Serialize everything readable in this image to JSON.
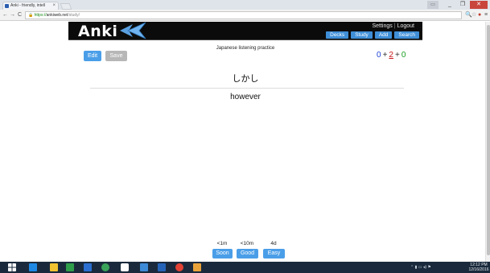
{
  "browser": {
    "tab_title": "Anki - friendly, intell",
    "tab_close": "×",
    "window_user": "▭",
    "window_min": "_",
    "window_max": "❐",
    "window_close": "✕",
    "nav_back": "←",
    "nav_forward": "→",
    "nav_reload": "C",
    "url_scheme": "https://",
    "url_host": "ankiweb.net",
    "url_path": "/study/",
    "icon_search": "🔍",
    "icon_star": "☆",
    "icon_ext": "●",
    "icon_menu": "≡"
  },
  "header": {
    "logo": "Anki",
    "settings": "Settings",
    "separator": "|",
    "logout": "Logout",
    "nav": [
      "Decks",
      "Study",
      "Add",
      "Search"
    ]
  },
  "study": {
    "edit_label": "Edit",
    "save_label": "Save",
    "deck_name": "Japanese listening practice",
    "counts": {
      "new": "0",
      "learn": "2",
      "review": "0",
      "plus": "+"
    },
    "front": "しかし",
    "back": "however",
    "answers": [
      {
        "time": "<1m",
        "label": "Soon"
      },
      {
        "time": "<10m",
        "label": "Good"
      },
      {
        "time": "4d",
        "label": "Easy"
      }
    ]
  },
  "taskbar": {
    "tray": "⌃ ▮ ▭ ◂) ⚑",
    "clock_time": "12:12 PM",
    "clock_date": "12/16/2016"
  },
  "colors": {
    "accent": "#4a9ee8",
    "header_bg": "#0b0b0b",
    "new_count": "#1b3fd6",
    "learn_count": "#c8171b",
    "review_count": "#169c1e"
  }
}
